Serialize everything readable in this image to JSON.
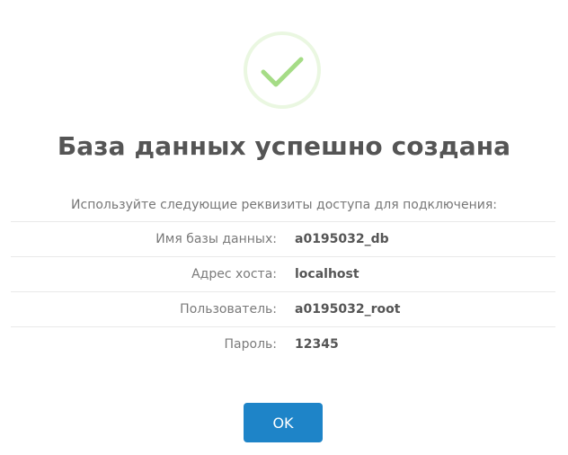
{
  "dialog": {
    "title": "База данных успешно создана",
    "intro": "Используйте следующие реквизиты доступа для подключения:",
    "details": [
      {
        "label": "Имя базы данных:",
        "value": "a0195032_db"
      },
      {
        "label": "Адрес хоста:",
        "value": "localhost"
      },
      {
        "label": "Пользователь:",
        "value": "a0195032_root"
      },
      {
        "label": "Пароль:",
        "value": "12345"
      }
    ],
    "ok_label": "OK",
    "success_icon": "check-circle-icon"
  },
  "colors": {
    "success": "#a5dc86",
    "success_ring": "#eaf7e1",
    "button": "#1e84c8",
    "title": "#555555",
    "label": "#7a7a7a",
    "divider": "#e9e9e9"
  }
}
